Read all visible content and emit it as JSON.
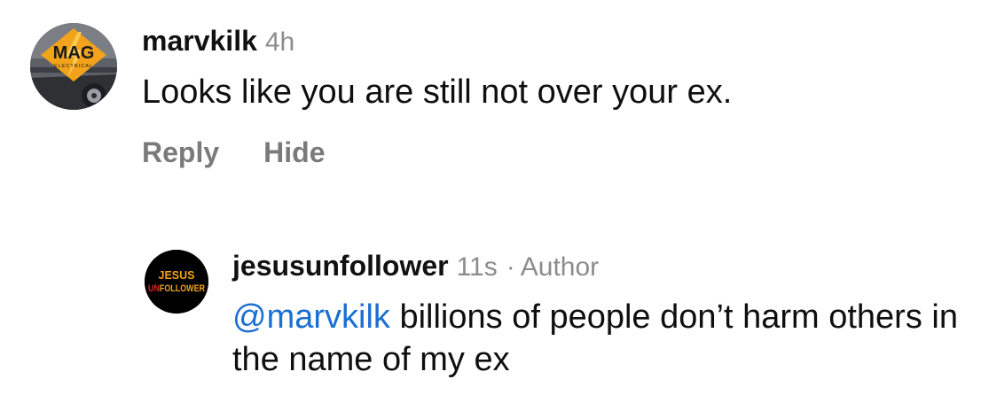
{
  "comments": [
    {
      "username": "marvkilk",
      "time": "4h",
      "text": "Looks like you are still not over your ex.",
      "avatar": {
        "icon": "mag-electrical-logo-avatar",
        "logo_text": "MAG",
        "logo_subtext": "ELECTRICAL"
      },
      "actions": {
        "reply": "Reply",
        "hide": "Hide"
      }
    },
    {
      "username": "jesusunfollower",
      "time": "11s",
      "separator": "·",
      "badge": "Author",
      "mention": "@marvkilk",
      "text": " billions of people don’t harm others in the name of my ex",
      "avatar": {
        "icon": "jesus-unfollower-logo-avatar",
        "logo_line1": "JESUS",
        "logo_line2_un": "UN",
        "logo_line2_rest": "FOLLOWER"
      }
    }
  ],
  "colors": {
    "username": "#111111",
    "meta": "#8c8c8c",
    "action": "#7a7a7a",
    "mention": "#1b6fd1",
    "logo_orange": "#f2a21b",
    "logo_red": "#d9261c"
  }
}
